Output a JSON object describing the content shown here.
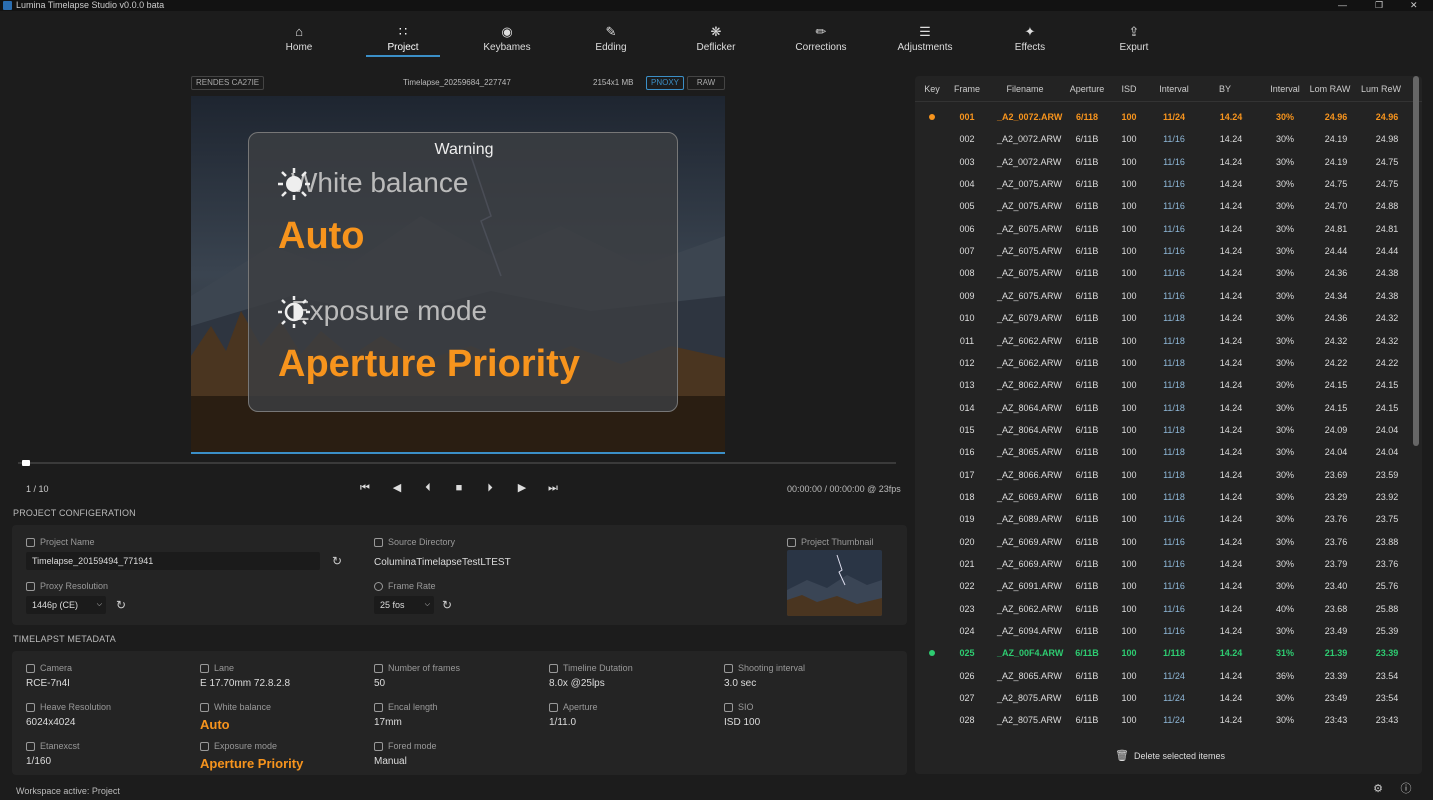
{
  "app": {
    "title": "Lumina Timelapse Studio v0.0.0 bata"
  },
  "nav": [
    {
      "label": "Home",
      "icon": "home-icon"
    },
    {
      "label": "Project",
      "icon": "grid-icon"
    },
    {
      "label": "Keybames",
      "icon": "eye-icon"
    },
    {
      "label": "Edding",
      "icon": "edit-icon"
    },
    {
      "label": "Deflicker",
      "icon": "sparkle-icon"
    },
    {
      "label": "Corrections",
      "icon": "eraser-icon"
    },
    {
      "label": "Adjustments",
      "icon": "sliders-icon"
    },
    {
      "label": "Effects",
      "icon": "wand-icon"
    },
    {
      "label": "Expurt",
      "icon": "export-icon"
    }
  ],
  "viewer": {
    "left_tag": "RENDES CA27IE",
    "filename": "Timelapse_20259684_227747",
    "size": "2154x1 MB",
    "proxy_label": "PNOXY",
    "raw_label": "RAW",
    "warning": {
      "title": "Warning",
      "wb_label": "White balance",
      "wb_value": "Auto",
      "exp_label": "Exposure mode",
      "exp_value": "Aperture Priority"
    },
    "frame_counter": "1 / 10",
    "timecode": "00:00:00 / 00:00:00 @ 23fps",
    "playhead_fraction": 0.004
  },
  "config": {
    "section_title": "PROJECT CONFIGERATION",
    "project_name_label": "Project Name",
    "project_name_value": "Timelapse_20159494_771941",
    "source_dir_label": "Source Directory",
    "source_dir_value": "ColuminaTimelapseTestLTEST",
    "thumb_label": "Project Thumbnail",
    "proxy_label": "Proxy Resolution",
    "proxy_value": "1446p (CE)",
    "fps_label": "Frame Rate",
    "fps_value": "25 fos"
  },
  "metadata": {
    "section_title": "TIMELAPST METADATA",
    "camera_label": "Camera",
    "camera_value": "RCE-7n4I",
    "lens_label": "Lane",
    "lens_value": "E 17.70mm 72.8.2.8",
    "frames_label": "Number of frames",
    "frames_value": "50",
    "duration_label": "Timeline Dutation",
    "duration_value": "8.0x @25lps",
    "interval_label": "Shooting interval",
    "interval_value": "3.0 sec",
    "res_label": "Heave Resolution",
    "res_value": "6024x4024",
    "wb_label": "White balance",
    "wb_value": "Auto",
    "focal_label": "Encal length",
    "focal_value": "17mm",
    "aperture_label": "Aperture",
    "aperture_value": "1/11.0",
    "iso_label": "SIO",
    "iso_value": "ISD 100",
    "exposure_label": "Etanexcst",
    "exposure_value": "1/160",
    "expmode_label": "Exposure mode",
    "expmode_value": "Aperture Priority",
    "focus_label": "Fored mode",
    "focus_value": "Manual"
  },
  "table": {
    "headers": [
      "Key",
      "Frame",
      "Filename",
      "Aperture",
      "ISD",
      "Interval",
      "BY",
      "Interval",
      "Lom RAW",
      "Lum ReW"
    ],
    "rows": [
      {
        "key": "orange",
        "frame": "001",
        "file": "_A2_0072.ARW",
        "ap": "6/118",
        "iso": "100",
        "int": "11/24",
        "by": "14.24",
        "pct": "30%",
        "raw": "24.96",
        "rew": "24.96"
      },
      {
        "key": "",
        "frame": "002",
        "file": "_A2_0072.ARW",
        "ap": "6/11B",
        "iso": "100",
        "int": "11/16",
        "by": "14.24",
        "pct": "30%",
        "raw": "24.19",
        "rew": "24.98"
      },
      {
        "key": "",
        "frame": "003",
        "file": "_A2_0072.ARW",
        "ap": "6/11B",
        "iso": "100",
        "int": "11/16",
        "by": "14.24",
        "pct": "30%",
        "raw": "24.19",
        "rew": "24.75"
      },
      {
        "key": "",
        "frame": "004",
        "file": "_AZ_0075.ARW",
        "ap": "6/11B",
        "iso": "100",
        "int": "11/16",
        "by": "14.24",
        "pct": "30%",
        "raw": "24.75",
        "rew": "24.75"
      },
      {
        "key": "",
        "frame": "005",
        "file": "_AZ_0075.ARW",
        "ap": "6/11B",
        "iso": "100",
        "int": "11/16",
        "by": "14.24",
        "pct": "30%",
        "raw": "24.70",
        "rew": "24.88"
      },
      {
        "key": "",
        "frame": "006",
        "file": "_AZ_6075.ARW",
        "ap": "6/11B",
        "iso": "100",
        "int": "11/16",
        "by": "14.24",
        "pct": "30%",
        "raw": "24.81",
        "rew": "24.81"
      },
      {
        "key": "",
        "frame": "007",
        "file": "_AZ_6075.ARW",
        "ap": "6/11B",
        "iso": "100",
        "int": "11/16",
        "by": "14.24",
        "pct": "30%",
        "raw": "24.44",
        "rew": "24.44"
      },
      {
        "key": "",
        "frame": "008",
        "file": "_AZ_6075.ARW",
        "ap": "6/11B",
        "iso": "100",
        "int": "11/16",
        "by": "14.24",
        "pct": "30%",
        "raw": "24.36",
        "rew": "24.38"
      },
      {
        "key": "",
        "frame": "009",
        "file": "_AZ_6075.ARW",
        "ap": "6/11B",
        "iso": "100",
        "int": "11/16",
        "by": "14.24",
        "pct": "30%",
        "raw": "24.34",
        "rew": "24.38"
      },
      {
        "key": "",
        "frame": "010",
        "file": "_AZ_6079.ARW",
        "ap": "6/11B",
        "iso": "100",
        "int": "11/18",
        "by": "14.24",
        "pct": "30%",
        "raw": "24.36",
        "rew": "24.32"
      },
      {
        "key": "",
        "frame": "011",
        "file": "_AZ_6062.ARW",
        "ap": "6/11B",
        "iso": "100",
        "int": "11/18",
        "by": "14.24",
        "pct": "30%",
        "raw": "24.32",
        "rew": "24.32"
      },
      {
        "key": "",
        "frame": "012",
        "file": "_AZ_6062.ARW",
        "ap": "6/11B",
        "iso": "100",
        "int": "11/18",
        "by": "14.24",
        "pct": "30%",
        "raw": "24.22",
        "rew": "24.22"
      },
      {
        "key": "",
        "frame": "013",
        "file": "_AZ_8062.ARW",
        "ap": "6/11B",
        "iso": "100",
        "int": "11/18",
        "by": "14.24",
        "pct": "30%",
        "raw": "24.15",
        "rew": "24.15"
      },
      {
        "key": "",
        "frame": "014",
        "file": "_AZ_8064.ARW",
        "ap": "6/11B",
        "iso": "100",
        "int": "11/18",
        "by": "14.24",
        "pct": "30%",
        "raw": "24.15",
        "rew": "24.15"
      },
      {
        "key": "",
        "frame": "015",
        "file": "_AZ_8064.ARW",
        "ap": "6/11B",
        "iso": "100",
        "int": "11/18",
        "by": "14.24",
        "pct": "30%",
        "raw": "24.09",
        "rew": "24.04"
      },
      {
        "key": "",
        "frame": "016",
        "file": "_AZ_8065.ARW",
        "ap": "6/11B",
        "iso": "100",
        "int": "11/18",
        "by": "14.24",
        "pct": "30%",
        "raw": "24.04",
        "rew": "24.04"
      },
      {
        "key": "",
        "frame": "017",
        "file": "_AZ_8066.ARW",
        "ap": "6/11B",
        "iso": "100",
        "int": "11/18",
        "by": "14.24",
        "pct": "30%",
        "raw": "23.69",
        "rew": "23.59"
      },
      {
        "key": "",
        "frame": "018",
        "file": "_AZ_6069.ARW",
        "ap": "6/11B",
        "iso": "100",
        "int": "11/18",
        "by": "14.24",
        "pct": "30%",
        "raw": "23.29",
        "rew": "23.92"
      },
      {
        "key": "",
        "frame": "019",
        "file": "_AZ_6089.ARW",
        "ap": "6/11B",
        "iso": "100",
        "int": "11/16",
        "by": "14.24",
        "pct": "30%",
        "raw": "23.76",
        "rew": "23.75"
      },
      {
        "key": "",
        "frame": "020",
        "file": "_AZ_6069.ARW",
        "ap": "6/11B",
        "iso": "100",
        "int": "11/16",
        "by": "14.24",
        "pct": "30%",
        "raw": "23.76",
        "rew": "23.88"
      },
      {
        "key": "",
        "frame": "021",
        "file": "_AZ_6069.ARW",
        "ap": "6/11B",
        "iso": "100",
        "int": "11/16",
        "by": "14.24",
        "pct": "30%",
        "raw": "23.79",
        "rew": "23.76"
      },
      {
        "key": "",
        "frame": "022",
        "file": "_AZ_6091.ARW",
        "ap": "6/11B",
        "iso": "100",
        "int": "11/16",
        "by": "14.24",
        "pct": "30%",
        "raw": "23.40",
        "rew": "25.76"
      },
      {
        "key": "",
        "frame": "023",
        "file": "_AZ_6062.ARW",
        "ap": "6/11B",
        "iso": "100",
        "int": "11/16",
        "by": "14.24",
        "pct": "40%",
        "raw": "23.68",
        "rew": "25.88"
      },
      {
        "key": "",
        "frame": "024",
        "file": "_AZ_6094.ARW",
        "ap": "6/11B",
        "iso": "100",
        "int": "11/16",
        "by": "14.24",
        "pct": "30%",
        "raw": "23.49",
        "rew": "25.39"
      },
      {
        "key": "green",
        "frame": "025",
        "file": "_AZ_00F4.ARW",
        "ap": "6/11B",
        "iso": "100",
        "int": "1/118",
        "by": "14.24",
        "pct": "31%",
        "raw": "21.39",
        "rew": "23.39"
      },
      {
        "key": "",
        "frame": "026",
        "file": "_AZ_8065.ARW",
        "ap": "6/11B",
        "iso": "100",
        "int": "11/24",
        "by": "14.24",
        "pct": "36%",
        "raw": "23.39",
        "rew": "23.54"
      },
      {
        "key": "",
        "frame": "027",
        "file": "_A2_8075.ARW",
        "ap": "6/11B",
        "iso": "100",
        "int": "11/24",
        "by": "14.24",
        "pct": "30%",
        "raw": "23:49",
        "rew": "23:54"
      },
      {
        "key": "",
        "frame": "028",
        "file": "_A2_8075.ARW",
        "ap": "6/11B",
        "iso": "100",
        "int": "11/24",
        "by": "14.24",
        "pct": "30%",
        "raw": "23:43",
        "rew": "23:43"
      }
    ],
    "delete_label": "Delete selected itemes"
  },
  "status": {
    "text": "Workspace active: Project"
  },
  "colors": {
    "accent": "#3b8fc7",
    "orange": "#f7941d",
    "green": "#2ecc71"
  }
}
